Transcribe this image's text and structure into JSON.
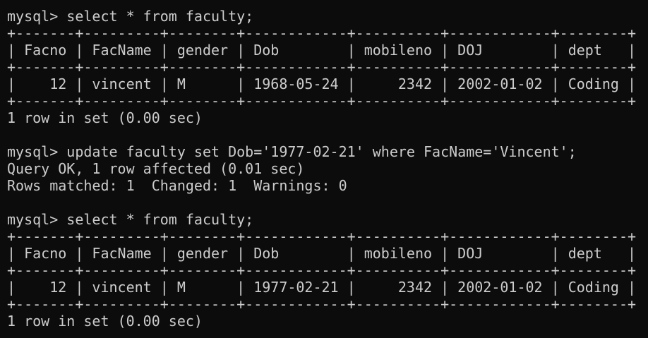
{
  "terminal": {
    "lines": [
      "mysql> select * from faculty;",
      "+-------+---------+--------+------------+----------+------------+--------+",
      "| Facno | FacName | gender | Dob        | mobileno | DOJ        | dept   |",
      "+-------+---------+--------+------------+----------+------------+--------+",
      "|    12 | vincent | M      | 1968-05-24 |     2342 | 2002-01-02 | Coding |",
      "+-------+---------+--------+------------+----------+------------+--------+",
      "1 row in set (0.00 sec)",
      "",
      "mysql> update faculty set Dob='1977-02-21' where FacName='Vincent';",
      "Query OK, 1 row affected (0.01 sec)",
      "Rows matched: 1  Changed: 1  Warnings: 0",
      "",
      "mysql> select * from faculty;",
      "+-------+---------+--------+------------+----------+------------+--------+",
      "| Facno | FacName | gender | Dob        | mobileno | DOJ        | dept   |",
      "+-------+---------+--------+------------+----------+------------+--------+",
      "|    12 | vincent | M      | 1977-02-21 |     2342 | 2002-01-02 | Coding |",
      "+-------+---------+--------+------------+----------+------------+--------+",
      "1 row in set (0.00 sec)"
    ]
  }
}
